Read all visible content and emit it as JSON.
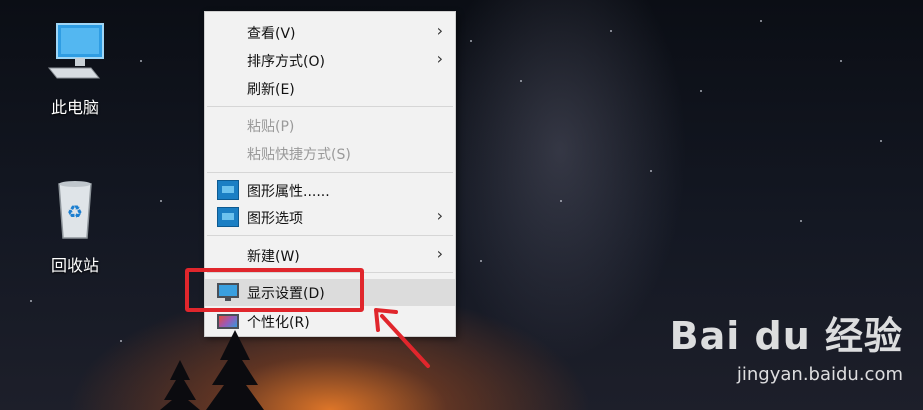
{
  "desktop": {
    "icons": [
      {
        "label": "此电脑",
        "icon": "computer-icon"
      },
      {
        "label": "回收站",
        "icon": "recycle-bin-icon"
      }
    ]
  },
  "context_menu": {
    "items": [
      {
        "label": "查看(V)",
        "submenu": true
      },
      {
        "label": "排序方式(O)",
        "submenu": true
      },
      {
        "label": "刷新(E)"
      },
      {
        "label": "粘贴(P)",
        "disabled": true
      },
      {
        "label": "粘贴快捷方式(S)",
        "disabled": true
      },
      {
        "label": "图形属性......",
        "icon": "intel-graphics-icon"
      },
      {
        "label": "图形选项",
        "icon": "intel-graphics-icon",
        "submenu": true
      },
      {
        "label": "新建(W)",
        "submenu": true
      },
      {
        "label": "显示设置(D)",
        "icon": "display-settings-icon",
        "highlighted": true
      },
      {
        "label": "个性化(R)",
        "icon": "personalize-icon"
      }
    ]
  },
  "annotation": {
    "highlight_color": "#e0262c"
  },
  "watermark": {
    "brand": "Bai du 经验",
    "url": "jingyan.baidu.com"
  }
}
